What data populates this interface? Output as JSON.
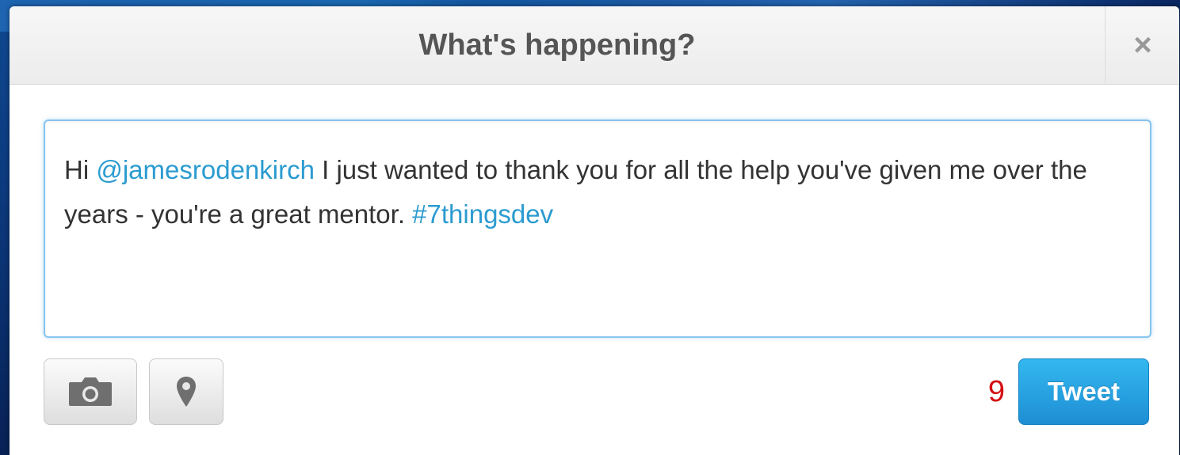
{
  "dialog": {
    "title": "What's happening?",
    "close_label": "×"
  },
  "compose": {
    "text_prefix": "Hi ",
    "mention": "@jamesrodenkirch",
    "text_middle": " I just wanted to thank you for all the help you've given me over the years - you're a great mentor. ",
    "hashtag": "#7thingsdev"
  },
  "toolbar": {
    "photo_icon": "camera-icon",
    "location_icon": "map-pin-icon",
    "char_count": "9",
    "tweet_label": "Tweet"
  },
  "colors": {
    "link": "#2b9bd0",
    "char_count_warning": "#d40d12",
    "tweet_button": "#2aa5e6"
  }
}
